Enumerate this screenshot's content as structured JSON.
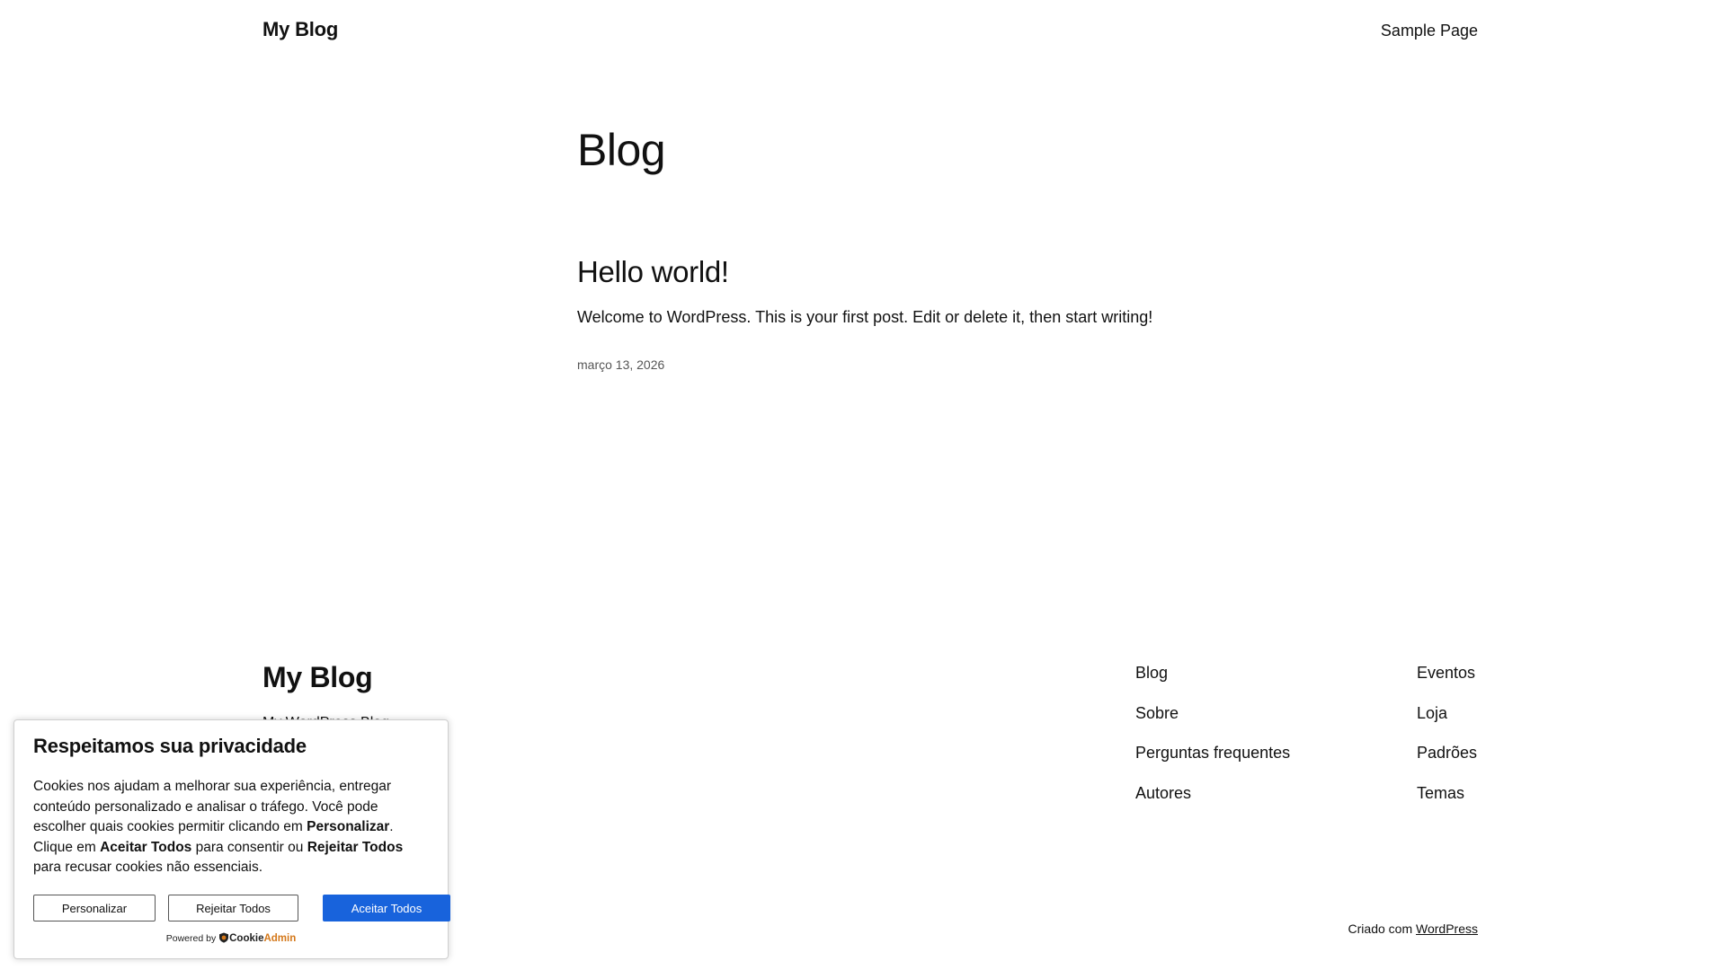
{
  "header": {
    "site_title": "My Blog",
    "nav_item": "Sample Page"
  },
  "main": {
    "page_title": "Blog",
    "post": {
      "title": "Hello world!",
      "excerpt": "Welcome to WordPress. This is your first post. Edit or delete it, then start writing!",
      "date": "março 13, 2026"
    }
  },
  "footer": {
    "site_title": "My Blog",
    "tagline": "My WordPress Blog",
    "col_a": [
      "Blog",
      "Sobre",
      "Perguntas frequentes",
      "Autores"
    ],
    "col_b": [
      "Eventos",
      "Loja",
      "Padrões",
      "Temas"
    ],
    "credits_prefix": "Criado com",
    "credits_link": "WordPress"
  },
  "cookie": {
    "title": "Respeitamos sua privacidade",
    "text_1": "Cookies nos ajudam a melhorar sua experiência, entregar conteúdo personalizado e analisar o tráfego. Você pode escolher quais cookies permitir clicando em ",
    "text_bold_1": "Personalizar",
    "text_2": ". Clique em ",
    "text_bold_2": "Aceitar Todos",
    "text_3": " para consentir ou ",
    "text_bold_3": "Rejeitar Todos",
    "text_4": " para recusar cookies não essenciais.",
    "btn_customize": "Personalizar",
    "btn_reject": "Rejeitar Todos",
    "btn_accept": "Aceitar Todos",
    "powered_by": "Powered by",
    "brand_a": "Cookie",
    "brand_b": "Admin",
    "accent_color": "#1863dc"
  }
}
